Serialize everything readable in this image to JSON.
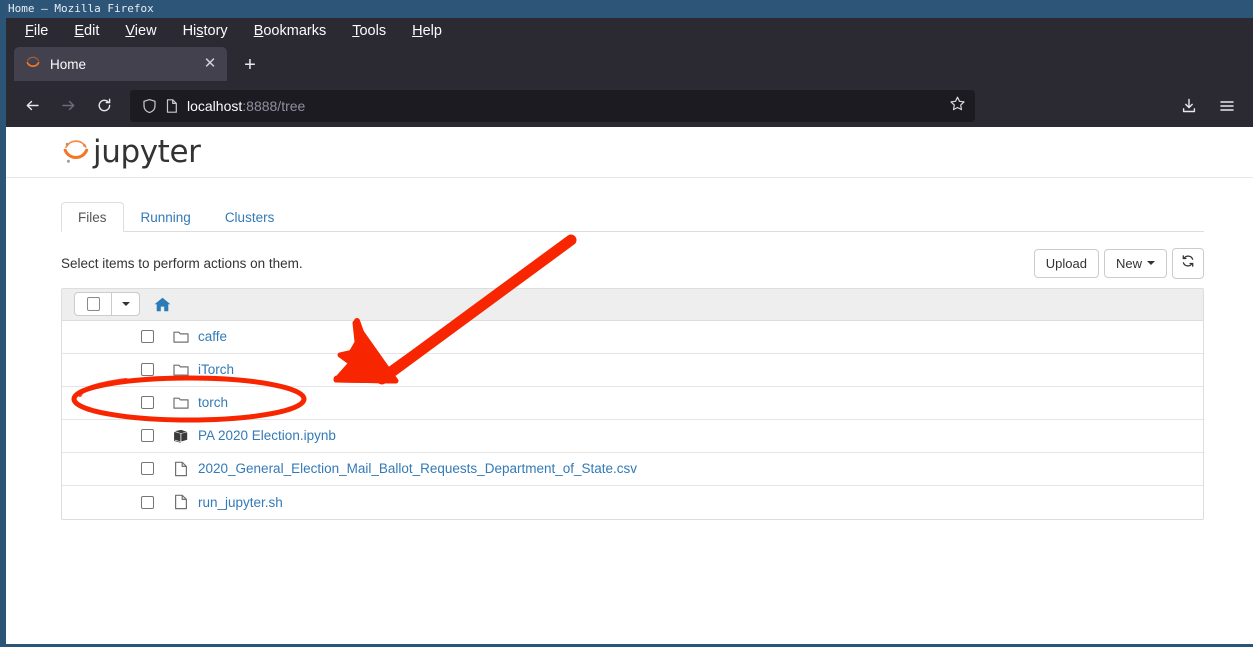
{
  "window": {
    "title": "Home — Mozilla Firefox"
  },
  "menubar": {
    "items": [
      {
        "label": "File",
        "accel": "F"
      },
      {
        "label": "Edit",
        "accel": "E"
      },
      {
        "label": "View",
        "accel": "V"
      },
      {
        "label": "History",
        "accel": "s"
      },
      {
        "label": "Bookmarks",
        "accel": "B"
      },
      {
        "label": "Tools",
        "accel": "T"
      },
      {
        "label": "Help",
        "accel": "H"
      }
    ]
  },
  "tabs": {
    "active": {
      "title": "Home",
      "favicon": "jupyter-favicon",
      "close_icon": "close-icon"
    },
    "new_tab_icon": "plus-icon"
  },
  "toolbar": {
    "back_icon": "back-arrow-icon",
    "forward_icon": "forward-arrow-icon",
    "reload_icon": "reload-icon",
    "shield_icon": "shield-icon",
    "page_icon": "page-info-icon",
    "bookmark_icon": "star-icon",
    "downloads_icon": "downloads-icon",
    "menu_icon": "hamburger-menu-icon",
    "url": {
      "host": "localhost",
      "rest": ":8888/tree",
      "full": "localhost:8888/tree"
    }
  },
  "page": {
    "logo_text": "jupyter",
    "tabs": [
      {
        "label": "Files",
        "active": true
      },
      {
        "label": "Running",
        "active": false
      },
      {
        "label": "Clusters",
        "active": false
      }
    ],
    "hint": "Select items to perform actions on them.",
    "buttons": {
      "upload": "Upload",
      "new": "New",
      "refresh_icon": "refresh-icon"
    },
    "breadcrumb_icon": "home-icon",
    "files": [
      {
        "name": "caffe",
        "type": "folder",
        "icon": "folder-icon"
      },
      {
        "name": "iTorch",
        "type": "folder",
        "icon": "folder-icon"
      },
      {
        "name": "torch",
        "type": "folder",
        "icon": "folder-icon"
      },
      {
        "name": "PA 2020 Election.ipynb",
        "type": "notebook",
        "icon": "notebook-icon",
        "highlighted": true
      },
      {
        "name": "2020_General_Election_Mail_Ballot_Requests_Department_of_State.csv",
        "type": "file",
        "icon": "file-icon"
      },
      {
        "name": "run_jupyter.sh",
        "type": "file",
        "icon": "file-icon"
      }
    ]
  },
  "annotation": {
    "arrow_icon": "red-arrow-annotation",
    "ellipse_icon": "red-ellipse-annotation",
    "color": "#f72600",
    "target": "PA 2020 Election.ipynb"
  },
  "colors": {
    "titlebar": "#2d5577",
    "chrome": "#2b2a33",
    "urlbar": "#1c1b22",
    "link": "#337ab7",
    "jupyter_orange": "#f37726",
    "annotation_red": "#f72600"
  }
}
